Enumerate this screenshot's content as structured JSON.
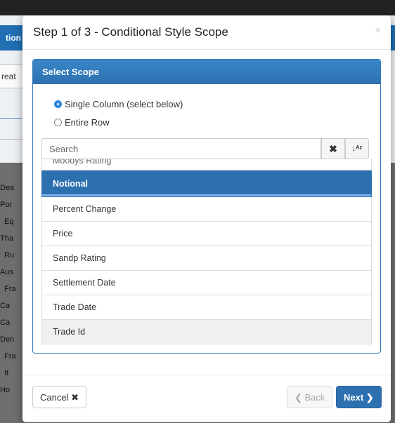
{
  "background": {
    "left_header_text": "tion",
    "left_tab_text": "reat",
    "row_fragments": [
      "Dea",
      "Por",
      "Eq",
      "Tha",
      "Ru",
      "Aus",
      "Fra",
      "Ca",
      "Ca",
      "Den",
      "Fra",
      "It",
      "Ho"
    ]
  },
  "modal": {
    "title": "Step 1 of 3 - Conditional Style Scope",
    "close_glyph": "×",
    "panel_heading": "Select Scope",
    "scope_options": [
      {
        "label": "Single Column (select below)",
        "selected": true
      },
      {
        "label": "Entire Row",
        "selected": false
      }
    ],
    "search": {
      "placeholder": "Search",
      "clear_icon": "✖",
      "sort_icon": "↓ᴬᶻ"
    },
    "columns": [
      {
        "label": "Moodys Rating",
        "state": "partial"
      },
      {
        "label": "Notional",
        "state": "selected"
      },
      {
        "label": "Percent Change",
        "state": "normal"
      },
      {
        "label": "Price",
        "state": "normal"
      },
      {
        "label": "Sandp Rating",
        "state": "normal"
      },
      {
        "label": "Settlement Date",
        "state": "normal"
      },
      {
        "label": "Trade Date",
        "state": "normal"
      },
      {
        "label": "Trade Id",
        "state": "hover"
      }
    ],
    "footer": {
      "cancel_label": "Cancel ✖",
      "back_label": "❮ Back",
      "next_label": "Next ❯"
    }
  },
  "colors": {
    "accent": "#2d70b0",
    "radio_selected": "#2e86de"
  }
}
